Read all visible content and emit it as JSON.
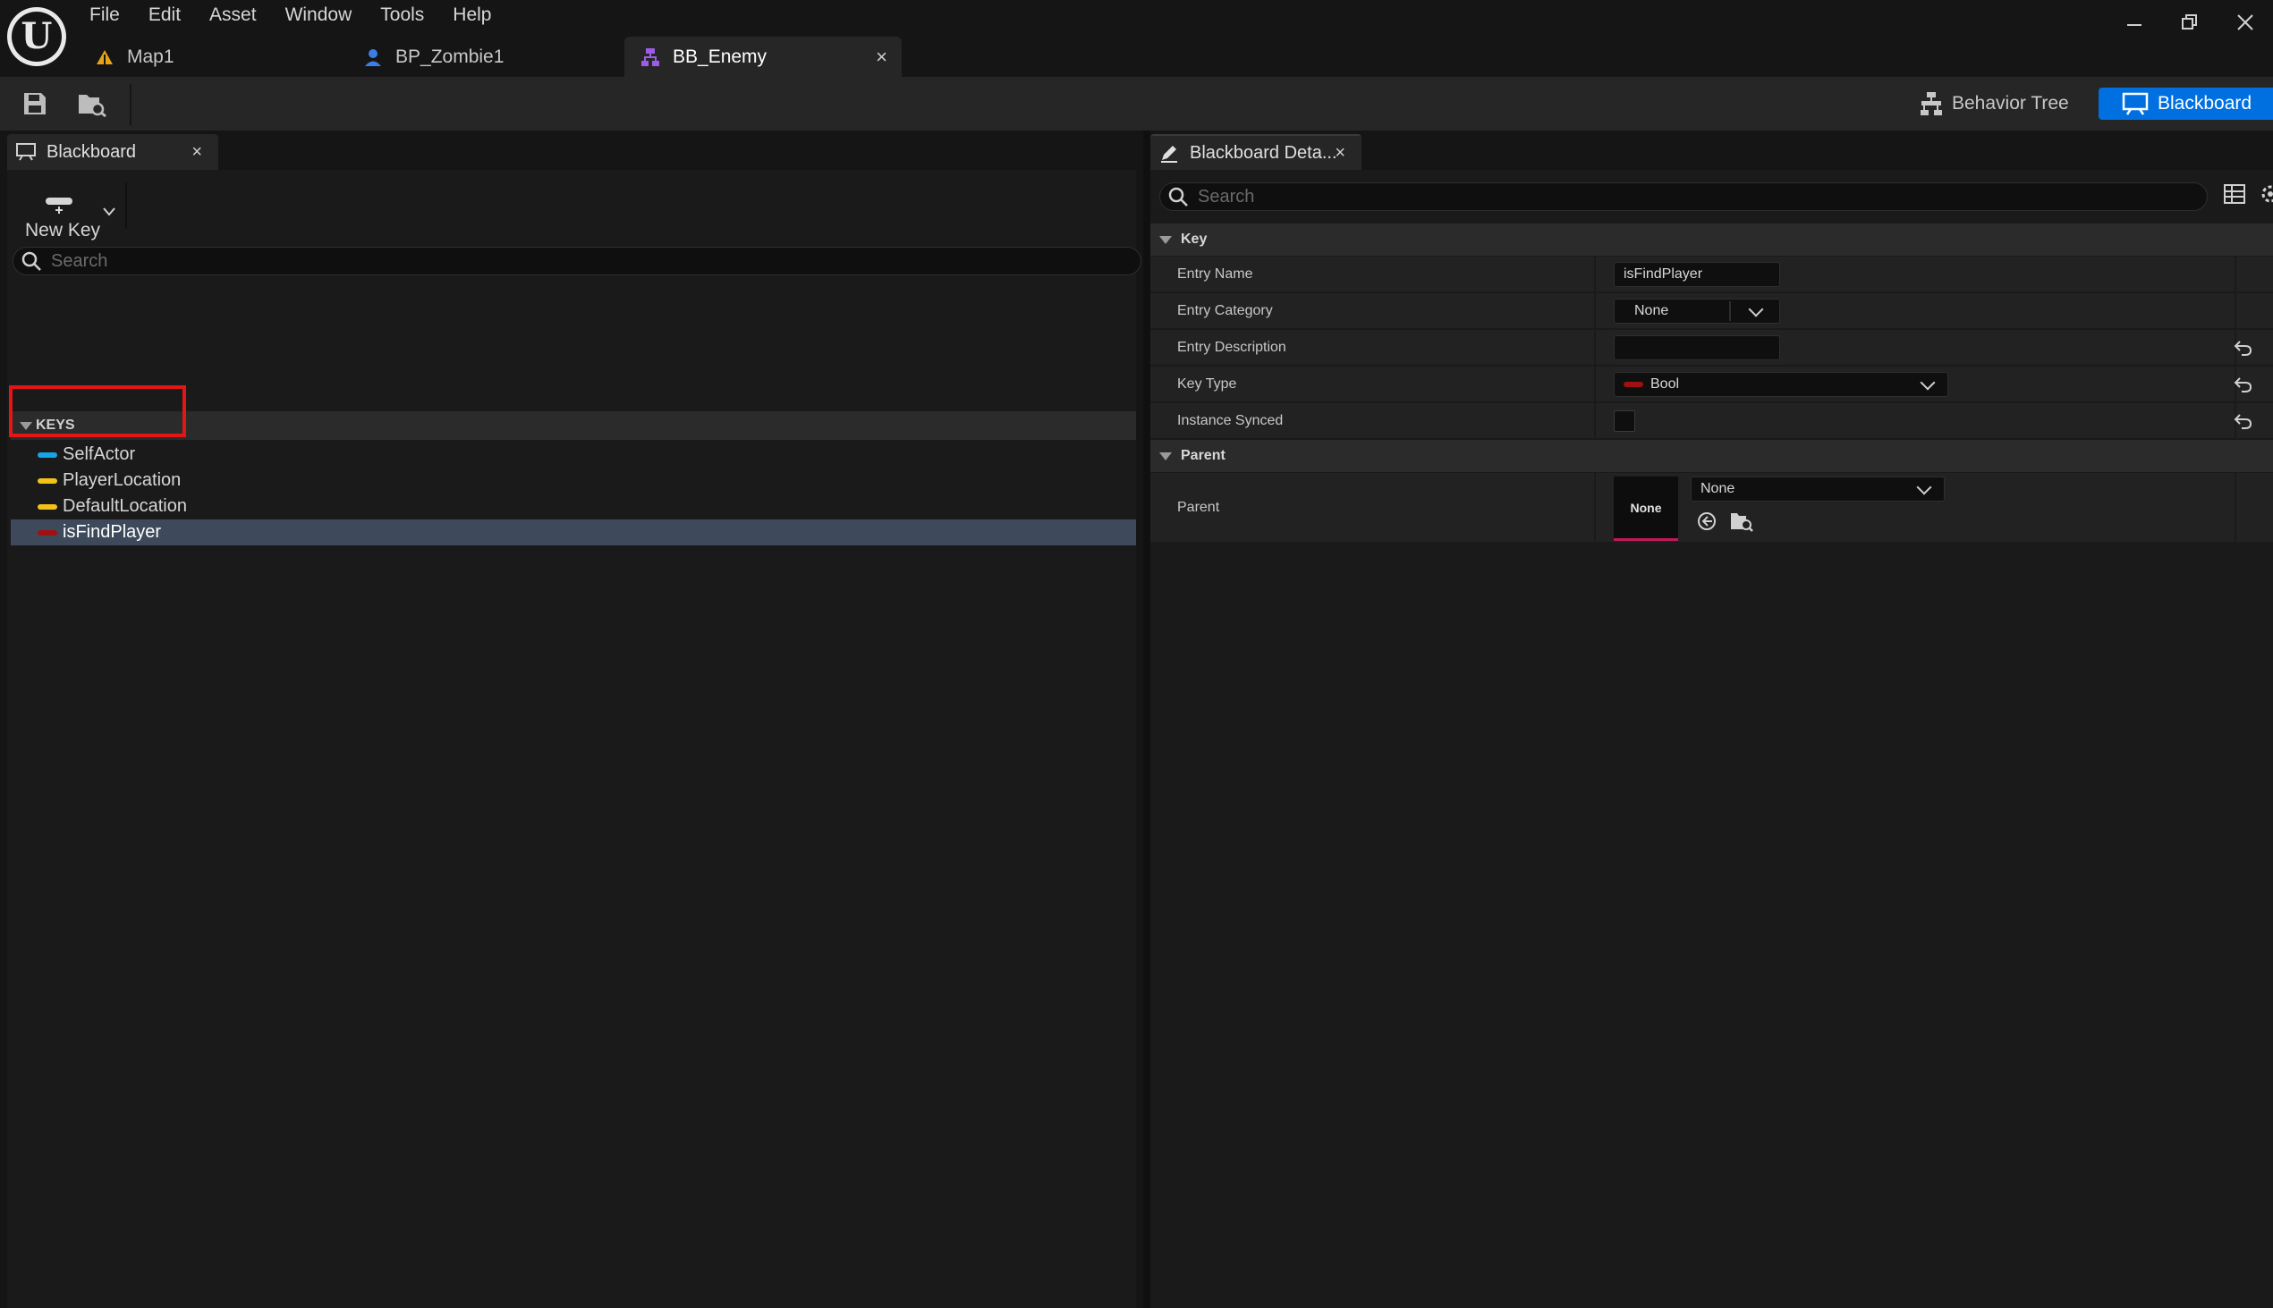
{
  "app": {
    "logo_letter": "U",
    "menu": [
      "File",
      "Edit",
      "Asset",
      "Window",
      "Tools",
      "Help"
    ]
  },
  "doc_tabs": [
    {
      "label": "Map1",
      "icon": "level-map-icon",
      "color": "#e8a317"
    },
    {
      "label": "BP_Zombie1",
      "icon": "blueprint-actor-icon",
      "color": "#3c7ee6"
    },
    {
      "label": "BB_Enemy",
      "icon": "behavior-tree-icon",
      "color": "#9b5de5",
      "active": true
    }
  ],
  "toolbar": {
    "modes": [
      {
        "label": "Behavior Tree",
        "icon": "behavior-tree-mode-icon"
      },
      {
        "label": "Blackboard",
        "icon": "blackboard-mode-icon",
        "active": true
      }
    ],
    "accent": "#0070e0"
  },
  "blackboard_panel": {
    "tab_label": "Blackboard",
    "new_key_label": "New Key",
    "search_placeholder": "Search",
    "keys_header": "KEYS",
    "keys": [
      {
        "name": "SelfActor",
        "color": "#16a4e6"
      },
      {
        "name": "PlayerLocation",
        "color": "#f2c21a"
      },
      {
        "name": "DefaultLocation",
        "color": "#f2c21a"
      },
      {
        "name": "isFindPlayer",
        "color": "#a01010",
        "selected": true
      }
    ],
    "highlight_color": "#e31515"
  },
  "details_panel": {
    "tab_label": "Blackboard Deta...",
    "search_placeholder": "Search",
    "key_category": "Key",
    "rows": {
      "entry_name": {
        "label": "Entry Name",
        "value": "isFindPlayer"
      },
      "entry_category": {
        "label": "Entry Category",
        "value": "None"
      },
      "entry_description": {
        "label": "Entry Description",
        "value": ""
      },
      "key_type": {
        "label": "Key Type",
        "value": "Bool",
        "color": "#a01010"
      },
      "instance_synced": {
        "label": "Instance Synced",
        "checked": false
      }
    },
    "parent_category": "Parent",
    "parent_row": {
      "label": "Parent",
      "thumbnail_label": "None",
      "value": "None",
      "thumb_accent": "#c2185b"
    }
  }
}
